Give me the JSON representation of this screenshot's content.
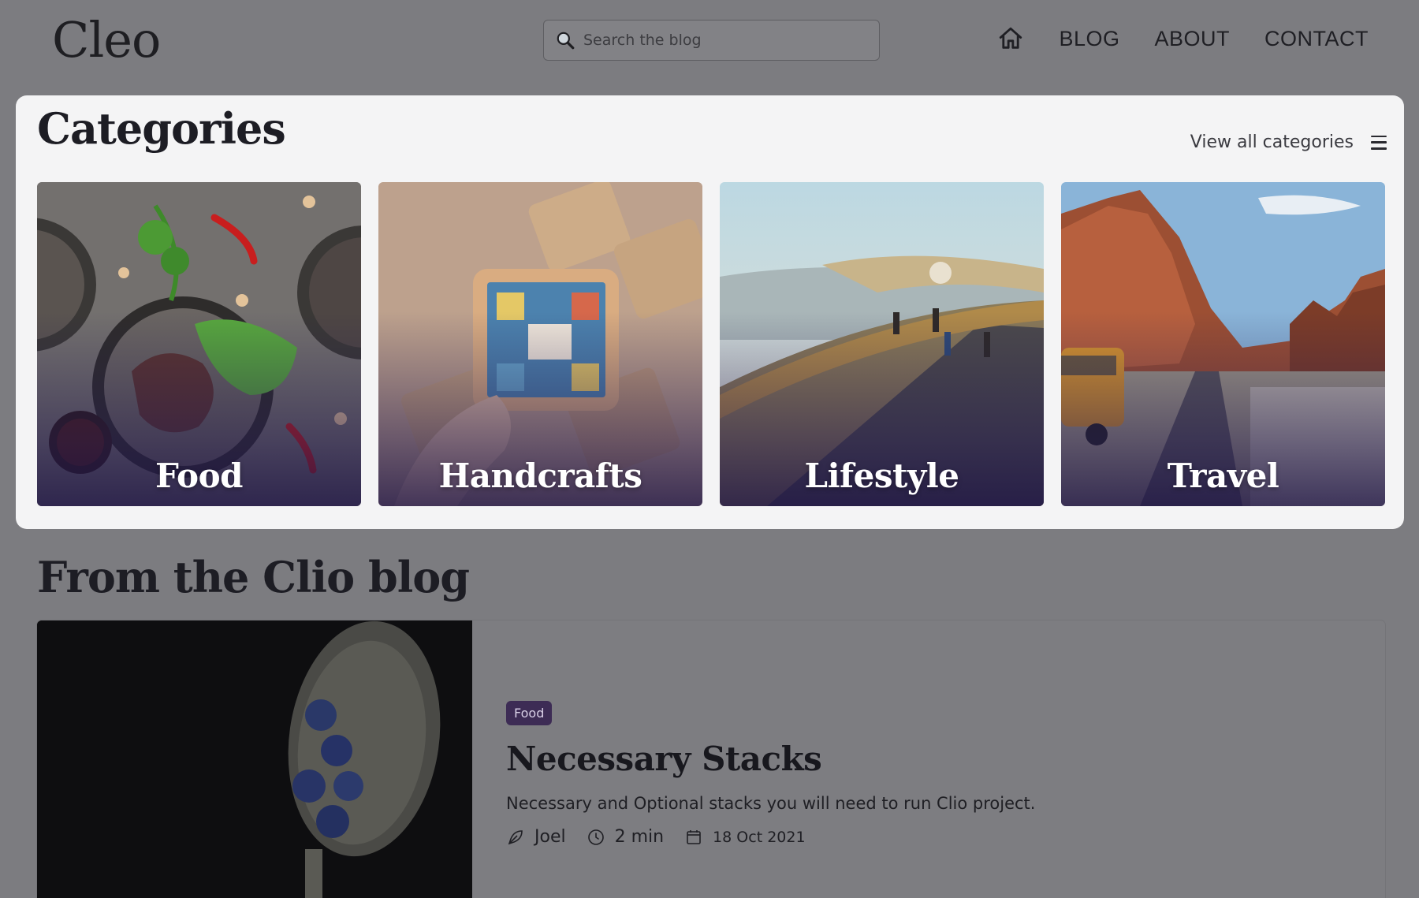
{
  "header": {
    "logo": "Cleo",
    "search_placeholder": "Search the blog",
    "nav": [
      "BLOG",
      "ABOUT",
      "CONTACT"
    ]
  },
  "categories": {
    "title": "Categories",
    "view_all": "View all categories",
    "items": [
      {
        "label": "Food"
      },
      {
        "label": "Handcrafts"
      },
      {
        "label": "Lifestyle"
      },
      {
        "label": "Travel"
      }
    ]
  },
  "blog": {
    "title": "From the Clio blog",
    "post": {
      "tag": "Food",
      "title": "Necessary Stacks",
      "description": "Necessary and Optional stacks you will need to run Clio project.",
      "author": "Joel",
      "read_time": "2 min",
      "date": "18 Oct 2021"
    }
  },
  "colors": {
    "overlay_bg": "#7c7c80",
    "panel_bg": "#f4f4f5",
    "tag_bg": "#3d2c55"
  }
}
